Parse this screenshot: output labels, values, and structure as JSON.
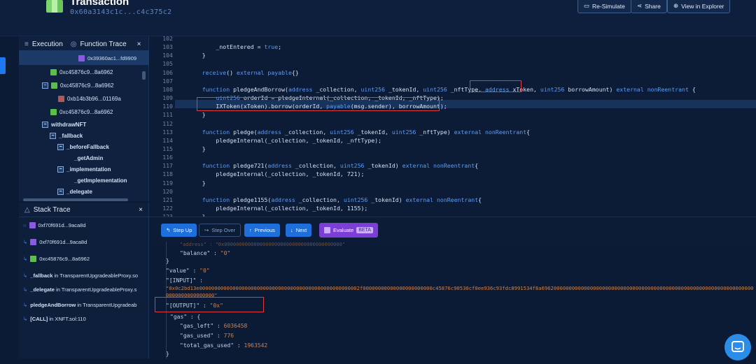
{
  "header": {
    "title": "Transaction",
    "hash": "0x60a3143c1c...c4c375c2",
    "buttons": [
      "Re-Simulate",
      "Share",
      "View in Explorer"
    ]
  },
  "trace_panel": {
    "tab_execution": "Execution",
    "tab_function_trace": "Function Trace",
    "close": "×",
    "rows": [
      {
        "text": "0x39360ac1...fd9909",
        "icon": "purple",
        "selected": true
      },
      {
        "text": "0xc45876c9...8a6962",
        "icon": "green"
      },
      {
        "text": "0xc45876c9...8a6962",
        "icon": "green",
        "toggle": "−"
      },
      {
        "text": "0xb14b3b96...01169a",
        "icon": "red"
      },
      {
        "text": "0xc45876c9...8a6962",
        "icon": "green"
      },
      {
        "text": "withdrawNFT",
        "toggle": "−"
      },
      {
        "text": "_fallback",
        "toggle": "−"
      },
      {
        "text": "_beforeFallback",
        "toggle": "−"
      },
      {
        "text": "_getAdmin"
      },
      {
        "text": "_implementation",
        "toggle": "−"
      },
      {
        "text": "_getImplementation"
      },
      {
        "text": "_delegate",
        "toggle": "−"
      }
    ]
  },
  "stack_panel": {
    "title": "Stack Trace",
    "close": "×",
    "rows": [
      {
        "text": "0xf70f691d...9aca8d",
        "icon": "purple"
      },
      {
        "text": "0xf70f691d...9aca8d",
        "icon": "purple"
      },
      {
        "text": "0xc45876c9...8a6962",
        "icon": "green"
      },
      {
        "fn": "_fallback",
        "mid": " in ",
        "ctx": "TransparentUpgradeableProxy.so"
      },
      {
        "fn": "_delegate",
        "mid": " in ",
        "ctx": "TransparentUpgradeableProxy.s"
      },
      {
        "fn": "pledgeAndBorrow",
        "mid": " in ",
        "ctx": "TransparentUpgradeab"
      },
      {
        "fn": "[CALL]",
        "mid": " in ",
        "ctx": "XNFT.sol:110"
      }
    ]
  },
  "code": {
    "lines": [
      {
        "n": "102",
        "t": "        "
      },
      {
        "n": "103",
        "t": "        _notEntered = true;"
      },
      {
        "n": "104",
        "t": "    }"
      },
      {
        "n": "105",
        "t": ""
      },
      {
        "n": "106",
        "t": "    receive() external payable{}"
      },
      {
        "n": "107",
        "t": ""
      },
      {
        "n": "108",
        "t": "    function pledgeAndBorrow(address _collection, uint256 _tokenId, uint256 _nftType, address xToken, uint256 borrowAmount) external nonReentrant {"
      },
      {
        "n": "109",
        "t": "        uint256 orderId = pledgeInternal(_collection, _tokenId, _nftType);"
      },
      {
        "n": "110",
        "t": "        IXToken(xToken).borrow(orderId, payable(msg.sender), borrowAmount);"
      },
      {
        "n": "111",
        "t": "    }"
      },
      {
        "n": "112",
        "t": ""
      },
      {
        "n": "113",
        "t": "    function pledge(address _collection, uint256 _tokenId, uint256 _nftType) external nonReentrant{"
      },
      {
        "n": "114",
        "t": "        pledgeInternal(_collection, _tokenId, _nftType);"
      },
      {
        "n": "115",
        "t": "    }"
      },
      {
        "n": "116",
        "t": ""
      },
      {
        "n": "117",
        "t": "    function pledge721(address _collection, uint256 _tokenId) external nonReentrant{"
      },
      {
        "n": "118",
        "t": "        pledgeInternal(_collection, _tokenId, 721);"
      },
      {
        "n": "119",
        "t": "    }"
      },
      {
        "n": "120",
        "t": ""
      },
      {
        "n": "121",
        "t": "    function pledge1155(address _collection, uint256 _tokenId) external nonReentrant{"
      },
      {
        "n": "122",
        "t": "        pledgeInternal(_collection, _tokenId, 1155);"
      },
      {
        "n": "123",
        "t": "    }"
      }
    ],
    "highlighted_line": "110"
  },
  "toolbar": {
    "step_up": "Step Up",
    "step_over": "Step Over",
    "previous": "Previous",
    "next": "Next",
    "evaluate": "Evaluate",
    "beta": "BETA"
  },
  "json": {
    "address_line": "\"address\" : \"0x0000000000000000000000000000000000000000\"",
    "balance_key": "\"balance\" : ",
    "balance_val": "\"0\"",
    "brace1": "}",
    "value_key": "\"value\" : ",
    "value_val": "\"0\"",
    "input_key": "\"[INPUT]\" :",
    "input_val": "\"0x0c2bd13e00000000000000000000000000000000000000000000000000002f00000000000000000000000c45876c90530cf0ee936c93fdc8991534f8a69620000000000000000000000000000000000000000000000000000000000000000000000000000000000\"",
    "output_key": "\"[OUTPUT]\" : ",
    "output_val": "\"0x\"",
    "gas_key": "\"gas\" : {",
    "gas_left_key": "\"gas_left\" : ",
    "gas_left_val": "6036458",
    "gas_used_key": "\"gas_used\" : ",
    "gas_used_val": "776",
    "total_gas_key": "\"total_gas_used\" : ",
    "total_gas_val": "1963542",
    "brace2": "}"
  }
}
